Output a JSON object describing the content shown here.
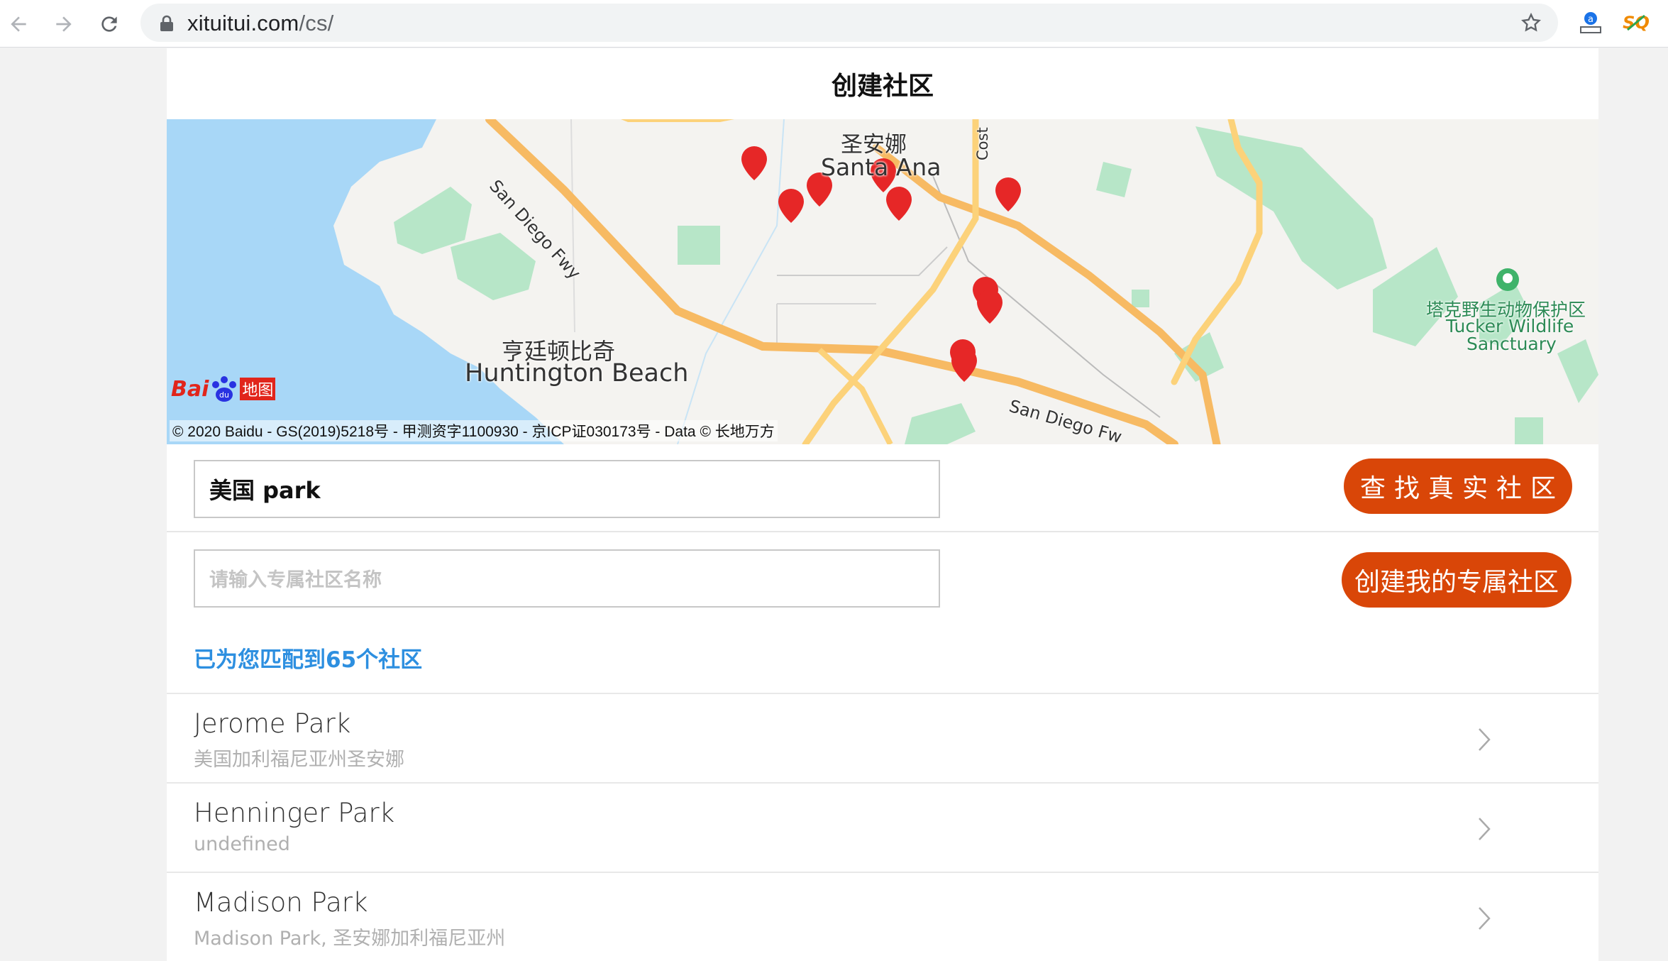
{
  "browser": {
    "url_host": "xituitui.com",
    "url_path": "/cs/"
  },
  "page": {
    "title": "创建社区"
  },
  "map": {
    "labels": {
      "santa_ana_cn": "圣安娜",
      "santa_ana_en": "Santa Ana",
      "huntington_cn": "亨廷顿比奇",
      "huntington_en": "Huntington Beach",
      "tucker_cn": "塔克野生动物保护区",
      "tucker_en1": "Tucker Wildlife",
      "tucker_en2": "Sanctuary",
      "fwy1": "San Diego Fwy",
      "fwy2": "San Diego Fw",
      "cost": "Cost"
    },
    "logo_text": "Bai",
    "logo_text2": "地图",
    "copyright": "© 2020 Baidu - GS(2019)5218号 - 甲测资字1100930 - 京ICP证030173号 - Data © 长地万方"
  },
  "search": {
    "value": "美国 park",
    "button_label": "查找真实社区"
  },
  "create": {
    "placeholder": "请输入专属社区名称",
    "button_label": "创建我的专属社区"
  },
  "match_text": "已为您匹配到65个社区",
  "communities": [
    {
      "name": "Jerome Park",
      "address": "美国加利福尼亚州圣安娜"
    },
    {
      "name": "Henninger Park",
      "address": "undefined"
    },
    {
      "name": "Madison Park",
      "address": "Madison Park, 圣安娜加利福尼亚州"
    }
  ],
  "colors": {
    "accent_button": "#d94608",
    "match_text": "#2d8fe0",
    "water": "#a8d7f7",
    "park": "#b7e6c8",
    "highway": "#f7ba63",
    "marker": "#e62727"
  }
}
